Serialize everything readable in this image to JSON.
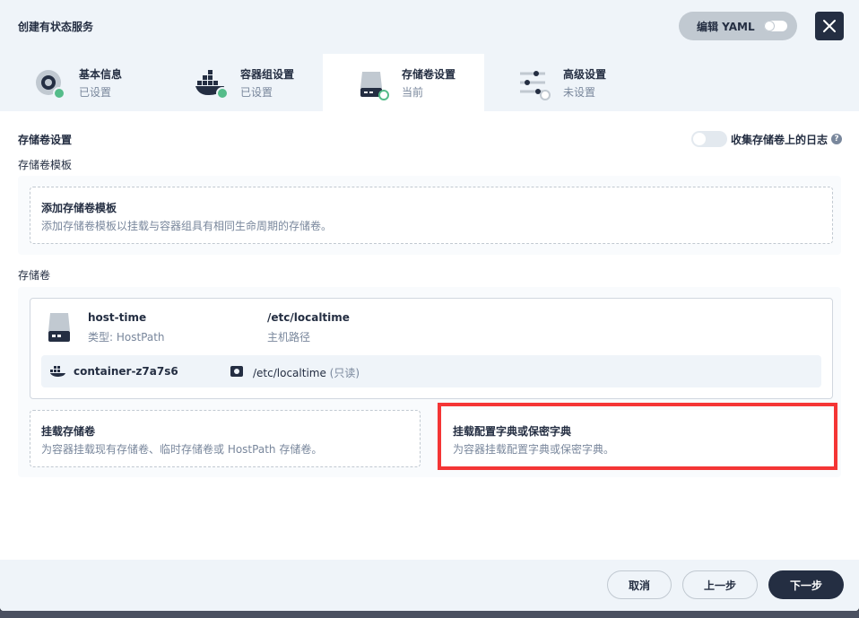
{
  "header": {
    "title": "创建有状态服务",
    "yaml_label": "编辑 YAML"
  },
  "tabs": [
    {
      "label": "基本信息",
      "status": "已设置",
      "icon": "disc-icon"
    },
    {
      "label": "容器组设置",
      "status": "已设置",
      "icon": "docker-icon"
    },
    {
      "label": "存储卷设置",
      "status": "当前",
      "icon": "storage-icon"
    },
    {
      "label": "高级设置",
      "status": "未设置",
      "icon": "sliders-icon"
    }
  ],
  "content": {
    "section_title": "存储卷设置",
    "log_label": "收集存储卷上的日志",
    "template_section": "存储卷模板",
    "add_template_title": "添加存储卷模板",
    "add_template_desc": "添加存储卷模板以挂载与容器组具有相同生命周期的存储卷。",
    "volumes_section": "存储卷",
    "volume": {
      "name": "host-time",
      "type": "类型: HostPath",
      "path": "/etc/localtime",
      "path_label": "主机路径",
      "container": "container-z7a7s6",
      "mount_path": "/etc/localtime",
      "mount_mode": "(只读)"
    },
    "mount_volume_title": "挂载存储卷",
    "mount_volume_desc": "为容器挂载现有存储卷、临时存储卷或 HostPath 存储卷。",
    "mount_config_title": "挂载配置字典或保密字典",
    "mount_config_desc": "为容器挂载配置字典或保密字典。"
  },
  "footer": {
    "cancel": "取消",
    "prev": "上一步",
    "next": "下一步"
  },
  "colors": {
    "primary": "#242e42",
    "success": "#55bc8a",
    "highlight": "#f43535",
    "muted": "#79879c"
  }
}
